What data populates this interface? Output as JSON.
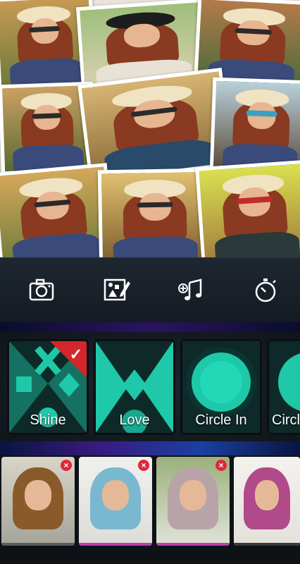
{
  "toolbar": {
    "tools": [
      {
        "name": "camera",
        "icon": "camera-icon"
      },
      {
        "name": "theme",
        "icon": "theme-edit-icon"
      },
      {
        "name": "music",
        "icon": "add-music-icon"
      },
      {
        "name": "duration",
        "icon": "timer-icon"
      }
    ]
  },
  "effects": {
    "items": [
      {
        "label": "Shine",
        "selected": true
      },
      {
        "label": "Love",
        "selected": false
      },
      {
        "label": "Circle In",
        "selected": false
      },
      {
        "label": "Circle",
        "selected": false
      }
    ]
  },
  "thumbnails": {
    "remove_symbol": "×",
    "count": 4
  },
  "colors": {
    "accent_red": "#d4262b",
    "effect_teal": "#1ec8a8",
    "toolbar_bg": "#1a222b"
  }
}
